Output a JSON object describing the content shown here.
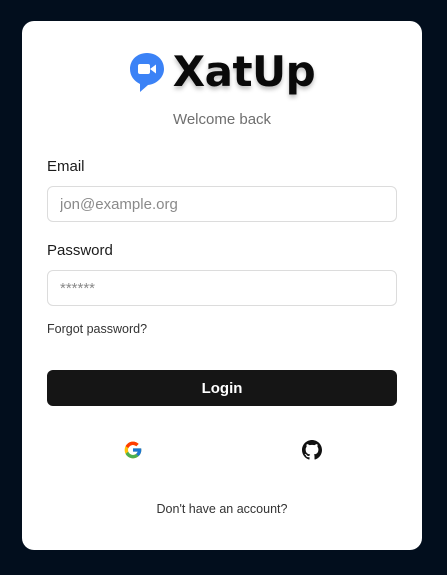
{
  "brand": {
    "name": "XatUp",
    "logo_icon": "chat-bubble-video-icon",
    "accent_color": "#3b82f6"
  },
  "subtitle": "Welcome back",
  "form": {
    "email_label": "Email",
    "email_placeholder": "jon@example.org",
    "password_label": "Password",
    "password_placeholder": "******",
    "forgot_label": "Forgot password?",
    "login_label": "Login"
  },
  "social": {
    "google_icon": "google-icon",
    "github_icon": "github-icon"
  },
  "footer": {
    "signup_text": "Don't have an account?"
  },
  "colors": {
    "background": "#020e1d",
    "card": "#ffffff",
    "button": "#151515"
  }
}
